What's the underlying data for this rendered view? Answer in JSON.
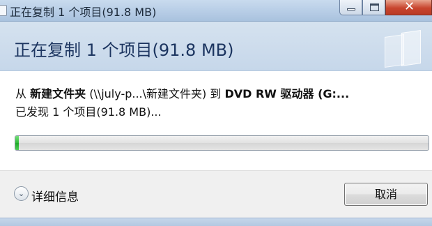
{
  "window": {
    "title": "正在复制 1 个项目(91.8 MB)",
    "min_symbol": "",
    "close_symbol": "✕"
  },
  "header": {
    "title": "正在复制 1 个项目(91.8 MB)"
  },
  "copy": {
    "prefix_from": "从 ",
    "source_name": "新建文件夹",
    "source_path": " (\\\\july-p...\\新建文件夹) 到 ",
    "destination": "DVD RW 驱动器 (G:...",
    "status": "已发现 1 个项目(91.8 MB)..."
  },
  "progress": {
    "percent": 0.5
  },
  "footer": {
    "details_label": "详细信息",
    "cancel_label": "取消"
  },
  "colors": {
    "progress_green": "#2fbb37",
    "title_blue": "#1c3560"
  },
  "icons": [
    "window-app-icon",
    "minimize-icon",
    "maximize-icon",
    "close-icon",
    "chevron-down-icon"
  ]
}
